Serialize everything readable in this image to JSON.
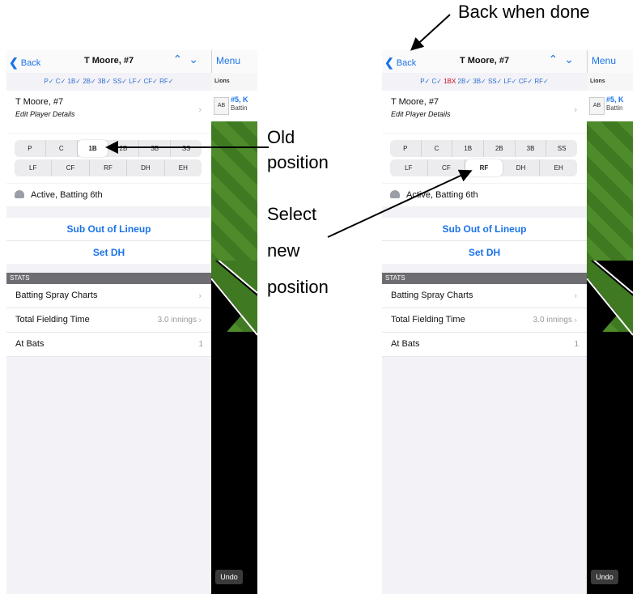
{
  "colors": {
    "accent": "#1a73e8",
    "error": "#d0021b",
    "stats_header": "#6d6d72",
    "field_green": "#4d8b2b"
  },
  "annotations": {
    "back_when_done": "Back when done",
    "old_1": "Old",
    "old_2": "position",
    "select_1": "Select",
    "select_2": "new",
    "select_3": "position"
  },
  "left": {
    "back": "Back",
    "title": "T Moore, #7",
    "pos_check": "P✓ C✓ 1B✓ 2B✓ 3B✓ SS✓ LF✓ CF✓ RF✓",
    "player_name": "T Moore, #7",
    "player_sub": "Edit Player Details",
    "row1": [
      "P",
      "C",
      "1B",
      "2B",
      "3B",
      "SS"
    ],
    "row2": [
      "LF",
      "CF",
      "RF",
      "DH",
      "EH"
    ],
    "selected": "1B",
    "active": "Active, Batting 6th",
    "sub_out": "Sub Out of Lineup",
    "set_dh": "Set DH",
    "stats_header": "STATS",
    "stat1": "Batting Spray Charts",
    "stat2": "Total Fielding Time",
    "stat2_val": "3.0 innings",
    "stat3": "At Bats",
    "stat3_val": "1",
    "menu": "Menu",
    "team": "Lions",
    "ab": "AB",
    "side_player": "#5, K",
    "side_batting": "Battin",
    "undo": "Undo"
  },
  "right": {
    "back": "Back",
    "title": "T Moore, #7",
    "pos_pre": "P✓ C✓ ",
    "pos_bad": "1BX",
    "pos_post": " 2B✓ 3B✓ SS✓ LF✓ CF✓ RF✓",
    "player_name": "T Moore, #7",
    "player_sub": "Edit Player Details",
    "row1": [
      "P",
      "C",
      "1B",
      "2B",
      "3B",
      "SS"
    ],
    "row2": [
      "LF",
      "CF",
      "RF",
      "DH",
      "EH"
    ],
    "selected": "RF",
    "active": "Active, Batting 6th",
    "sub_out": "Sub Out of Lineup",
    "set_dh": "Set DH",
    "stats_header": "STATS",
    "stat1": "Batting Spray Charts",
    "stat2": "Total Fielding Time",
    "stat2_val": "3.0 innings",
    "stat3": "At Bats",
    "stat3_val": "1",
    "menu": "Menu",
    "team": "Lions",
    "ab": "AB",
    "side_player": "#5, K",
    "side_batting": "Battin",
    "undo": "Undo"
  }
}
